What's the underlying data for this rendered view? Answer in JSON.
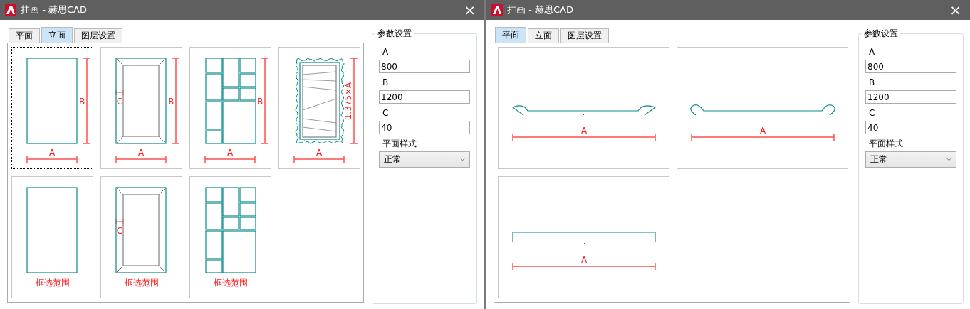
{
  "windows": [
    {
      "title": "挂画 - 赫思CAD",
      "close": "×",
      "tabs": [
        {
          "label": "平面",
          "selected": false
        },
        {
          "label": "立面",
          "selected": true
        },
        {
          "label": "图层设置",
          "selected": false
        }
      ],
      "tiles": [
        {
          "kind": "plain",
          "width_label": "A",
          "height_label": "B",
          "selected": true
        },
        {
          "kind": "bevel",
          "width_label": "A",
          "height_label": "B",
          "inset_label": "C",
          "selected": false
        },
        {
          "kind": "grid",
          "width_label": "A",
          "height_label": "B",
          "selected": false
        },
        {
          "kind": "ornate",
          "width_label": "A",
          "height_label": "1.375×A",
          "selected": false
        },
        {
          "kind": "plain",
          "caption": "框选范围",
          "selected": false
        },
        {
          "kind": "bevel",
          "inset_label": "C",
          "caption": "框选范围",
          "selected": false
        },
        {
          "kind": "grid",
          "caption": "框选范围",
          "selected": false
        }
      ],
      "params": {
        "title": "参数设置",
        "fields": [
          {
            "label": "A",
            "value": "800"
          },
          {
            "label": "B",
            "value": "1200"
          },
          {
            "label": "C",
            "value": "40"
          }
        ],
        "style_label": "平面样式",
        "style_value": "正常"
      }
    },
    {
      "title": "挂画 - 赫思CAD",
      "close": "×",
      "tabs": [
        {
          "label": "平面",
          "selected": true
        },
        {
          "label": "立面",
          "selected": false
        },
        {
          "label": "图层设置",
          "selected": false
        }
      ],
      "tiles": [
        {
          "kind": "ogee",
          "width_label": "A",
          "selected": false
        },
        {
          "kind": "round",
          "width_label": "A",
          "selected": false
        },
        {
          "kind": "flat",
          "width_label": "A",
          "selected": false
        }
      ],
      "params": {
        "title": "参数设置",
        "fields": [
          {
            "label": "A",
            "value": "800"
          },
          {
            "label": "B",
            "value": "1200"
          },
          {
            "label": "C",
            "value": "40"
          }
        ],
        "style_label": "平面样式",
        "style_value": "正常"
      }
    }
  ]
}
